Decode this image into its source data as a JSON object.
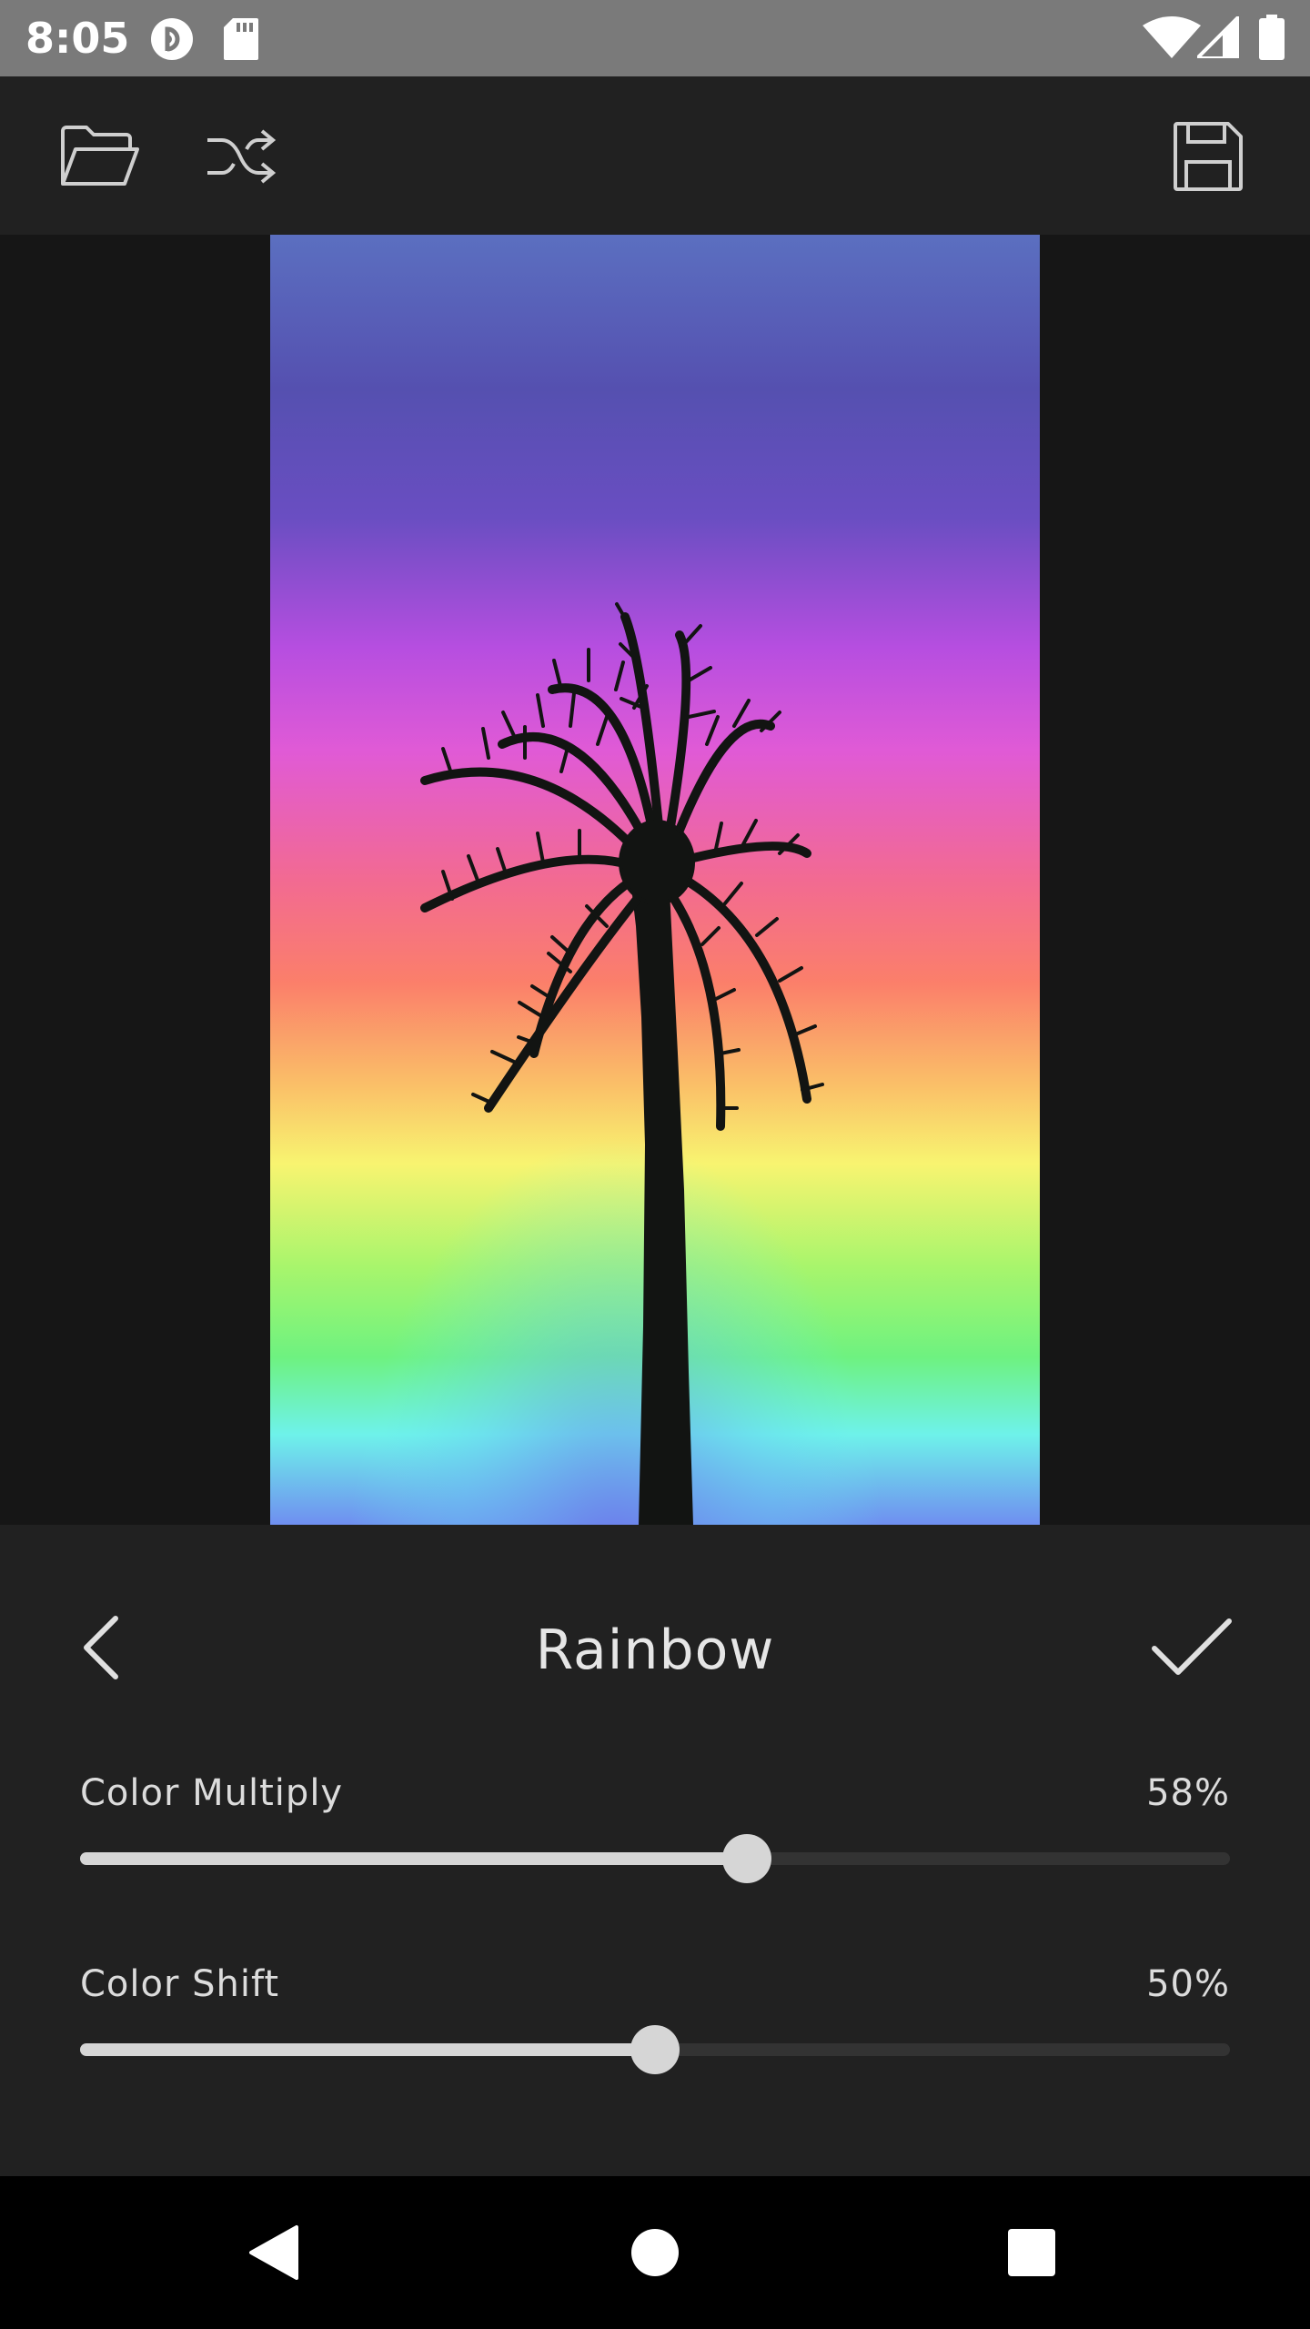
{
  "status_bar": {
    "time": "8:05",
    "icons": [
      "pocket-casts-icon",
      "sd-card-icon",
      "wifi-icon",
      "cellular-signal-icon",
      "battery-icon"
    ]
  },
  "toolbar": {
    "open_icon": "folder-open-icon",
    "shuffle_icon": "shuffle-icon",
    "save_icon": "floppy-save-icon"
  },
  "image": {
    "description_icon": "palm-tree-photo"
  },
  "panel": {
    "title": "Rainbow",
    "back_icon": "chevron-left-icon",
    "confirm_icon": "checkmark-icon",
    "sliders": [
      {
        "label": "Color Multiply",
        "value_text": "58%",
        "value": 0.58
      },
      {
        "label": "Color Shift",
        "value_text": "50%",
        "value": 0.5
      }
    ]
  },
  "nav_bar": {
    "back_icon": "nav-back-triangle-icon",
    "home_icon": "nav-home-circle-icon",
    "recents_icon": "nav-recents-square-icon"
  },
  "colors": {
    "status_bar": "#7a7a7a",
    "toolbar": "#212121",
    "panel": "#212121",
    "accent_light": "#d6d6d6",
    "track": "#333333"
  }
}
